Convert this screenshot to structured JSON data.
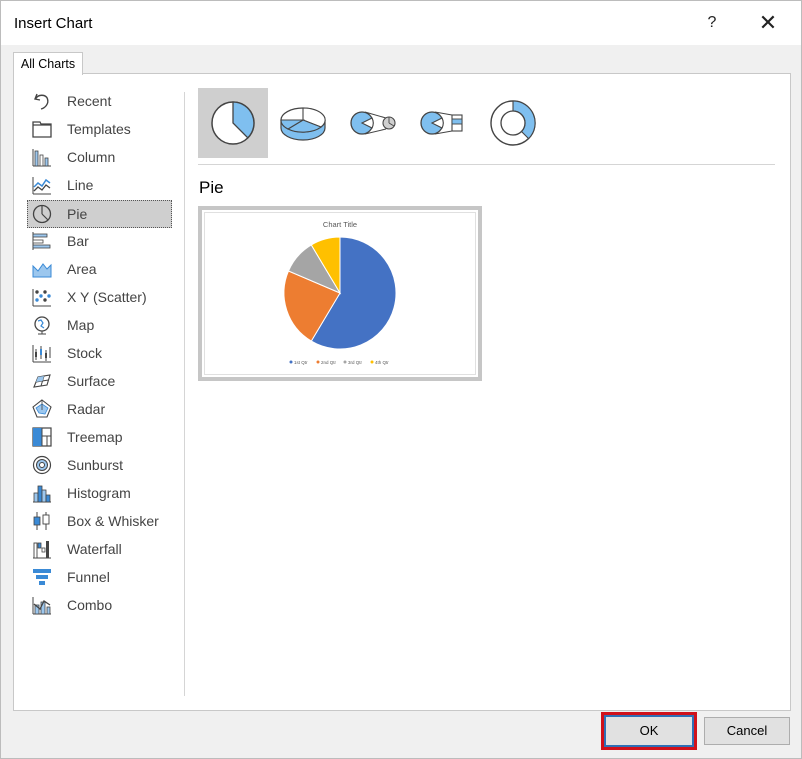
{
  "dialog": {
    "title": "Insert Chart",
    "help_label": "?",
    "close_label": "✕",
    "tab_label": "All Charts",
    "ok_label": "OK",
    "cancel_label": "Cancel"
  },
  "categories": [
    {
      "label": "Recent",
      "icon": "undo-icon"
    },
    {
      "label": "Templates",
      "icon": "folder-icon"
    },
    {
      "label": "Column",
      "icon": "column-chart-icon"
    },
    {
      "label": "Line",
      "icon": "line-chart-icon"
    },
    {
      "label": "Pie",
      "icon": "pie-chart-icon",
      "selected": true
    },
    {
      "label": "Bar",
      "icon": "bar-chart-icon"
    },
    {
      "label": "Area",
      "icon": "area-chart-icon"
    },
    {
      "label": "X Y (Scatter)",
      "icon": "scatter-chart-icon"
    },
    {
      "label": "Map",
      "icon": "map-chart-icon"
    },
    {
      "label": "Stock",
      "icon": "stock-chart-icon"
    },
    {
      "label": "Surface",
      "icon": "surface-chart-icon"
    },
    {
      "label": "Radar",
      "icon": "radar-chart-icon"
    },
    {
      "label": "Treemap",
      "icon": "treemap-chart-icon"
    },
    {
      "label": "Sunburst",
      "icon": "sunburst-chart-icon"
    },
    {
      "label": "Histogram",
      "icon": "histogram-chart-icon"
    },
    {
      "label": "Box & Whisker",
      "icon": "box-whisker-chart-icon"
    },
    {
      "label": "Waterfall",
      "icon": "waterfall-chart-icon"
    },
    {
      "label": "Funnel",
      "icon": "funnel-chart-icon"
    },
    {
      "label": "Combo",
      "icon": "combo-chart-icon"
    }
  ],
  "subtypes": [
    {
      "icon": "pie-subtype-icon",
      "selected": true
    },
    {
      "icon": "3d-pie-subtype-icon"
    },
    {
      "icon": "pie-of-pie-subtype-icon"
    },
    {
      "icon": "bar-of-pie-subtype-icon"
    },
    {
      "icon": "doughnut-subtype-icon"
    }
  ],
  "selected_chart_name": "Pie",
  "colors": {
    "accent_blue": "#4472c4",
    "orange": "#ed7d31",
    "gray": "#a5a5a5",
    "gold": "#ffc000",
    "ok_highlight": "#d0111b"
  },
  "chart_data": {
    "type": "pie",
    "title": "Chart Title",
    "categories": [
      "1st Qtr",
      "2nd Qtr",
      "3rd Qtr",
      "4th Qtr"
    ],
    "values": [
      8.2,
      3.2,
      1.4,
      1.2
    ],
    "colors": [
      "#4472c4",
      "#ed7d31",
      "#a5a5a5",
      "#ffc000"
    ],
    "legend": "bottom"
  }
}
